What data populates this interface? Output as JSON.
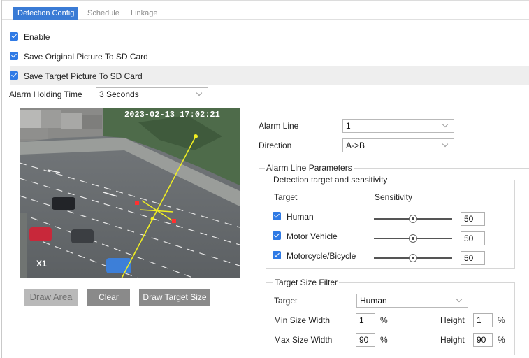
{
  "tabs": [
    {
      "label": "Detection Config",
      "active": true
    },
    {
      "label": "Schedule",
      "active": false
    },
    {
      "label": "Linkage",
      "active": false
    }
  ],
  "options": {
    "enable": {
      "label": "Enable",
      "checked": true
    },
    "save_original": {
      "label": "Save Original Picture To SD Card",
      "checked": true
    },
    "save_target": {
      "label": "Save Target Picture To SD Card",
      "checked": true
    }
  },
  "alarm_holding": {
    "label": "Alarm Holding Time",
    "value": "3 Seconds"
  },
  "preview": {
    "timestamp": "2023-02-13 17:02:21",
    "channel": "X1"
  },
  "buttons": {
    "draw_area": "Draw Area",
    "clear": "Clear",
    "draw_target_size": "Draw Target Size"
  },
  "alarm_line": {
    "label": "Alarm Line",
    "value": "1"
  },
  "direction": {
    "label": "Direction",
    "value": "A->B"
  },
  "alarm_line_params": {
    "legend": "Alarm Line Parameters",
    "detection": {
      "legend": "Detection target and sensitivity",
      "target_header": "Target",
      "sensitivity_header": "Sensitivity",
      "rows": [
        {
          "label": "Human",
          "checked": true,
          "value": "50",
          "level": 50
        },
        {
          "label": "Motor Vehicle",
          "checked": true,
          "value": "50",
          "level": 50
        },
        {
          "label": "Motorcycle/Bicycle",
          "checked": true,
          "value": "50",
          "level": 50
        }
      ]
    }
  },
  "size_filter": {
    "legend": "Target Size Filter",
    "target_label": "Target",
    "target_value": "Human",
    "min_width_label": "Min Size Width",
    "min_width": "1",
    "min_height_label": "Height",
    "min_height": "1",
    "max_width_label": "Max Size Width",
    "max_width": "90",
    "max_height_label": "Height",
    "max_height": "90",
    "unit": "%"
  },
  "colors": {
    "accent": "#2f7ae5",
    "tab_active": "#3a7bd5",
    "button": "#8a8a8a",
    "line": "#e8e000",
    "arrow": "#ff3030"
  },
  "icons": [
    "checkbox-checked-icon",
    "chevron-down-icon",
    "slider-knob-icon"
  ]
}
